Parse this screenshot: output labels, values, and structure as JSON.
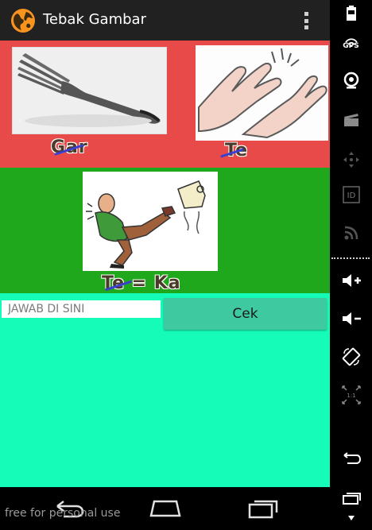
{
  "app": {
    "title": "Tebak Gambar",
    "icon": "globe-icon",
    "menu_icon": "overflow-menu-icon"
  },
  "puzzle": {
    "images": [
      {
        "name": "fork",
        "icon": "fork-photo"
      },
      {
        "name": "clapping-hands",
        "icon": "clapping-hands-photo"
      },
      {
        "name": "kick",
        "icon": "kick-cartoon-photo"
      }
    ],
    "clue_1": "Gar",
    "clue_2": "Te",
    "clue_3": "Te = Ka"
  },
  "answer": {
    "placeholder": "JAWAB DI SINI",
    "check_label": "Cek"
  },
  "nav": {
    "back": "back-icon",
    "home": "home-icon",
    "recents": "recents-icon"
  },
  "watermark": "free for personal use",
  "side_panel": {
    "gps_label": "GPS",
    "buttons": [
      "battery-icon",
      "gps-icon",
      "camera-icon",
      "clapperboard-icon",
      "dpad-icon",
      "id-icon",
      "rss-icon",
      "volume-up-icon",
      "volume-down-icon",
      "rotate-icon",
      "scale-icon",
      "back-icon",
      "recents-icon",
      "more-icon"
    ]
  },
  "colors": {
    "top_panel": "#e84a4a",
    "mid_panel": "#1fa81b",
    "answer_area": "#15fcb8",
    "check_button": "#3ec9a0",
    "action_bar": "#212121"
  }
}
